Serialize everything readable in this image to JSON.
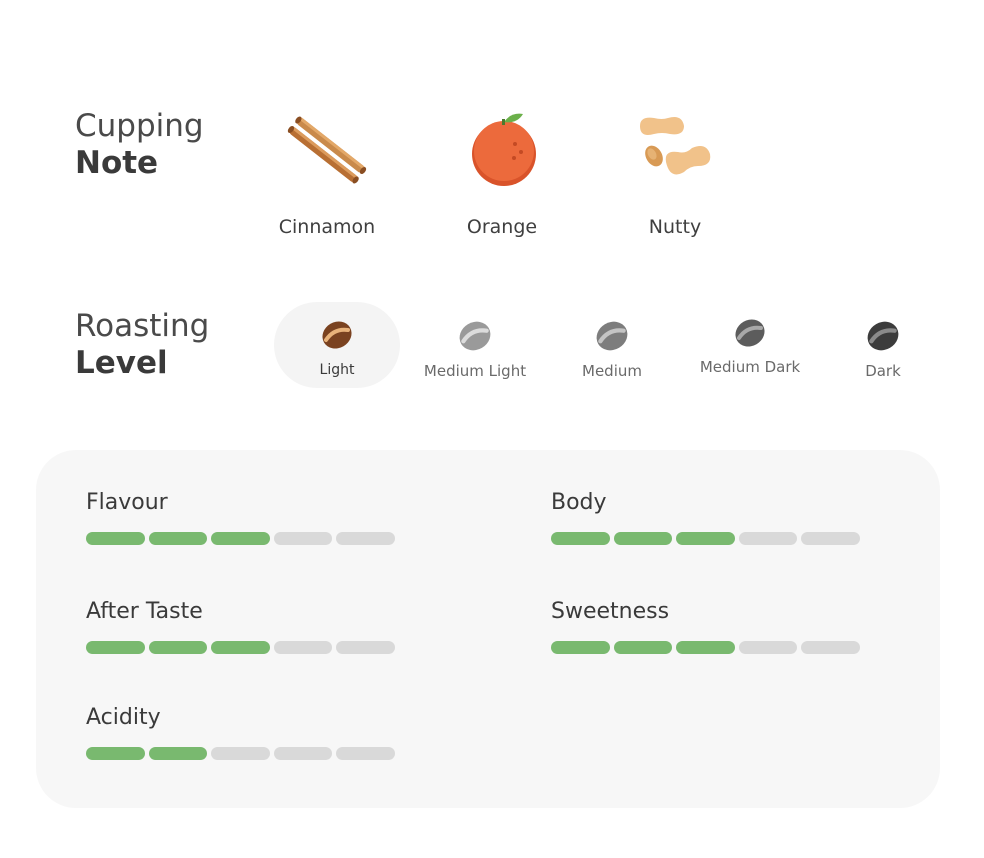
{
  "cupping": {
    "title_light": "Cupping",
    "title_bold": "Note",
    "notes": [
      {
        "label": "Cinnamon",
        "icon": "cinnamon-icon"
      },
      {
        "label": "Orange",
        "icon": "orange-icon"
      },
      {
        "label": "Nutty",
        "icon": "peanut-icon"
      }
    ]
  },
  "roasting": {
    "title_light": "Roasting",
    "title_bold": "Level",
    "selected": "Light",
    "levels": [
      {
        "label": "Light",
        "color": "#7a4220"
      },
      {
        "label": "Medium Light",
        "color": "#9a9a9a"
      },
      {
        "label": "Medium",
        "color": "#7d7d7d"
      },
      {
        "label": "Medium Dark",
        "color": "#5c5c5c"
      },
      {
        "label": "Dark",
        "color": "#3c3c3c"
      }
    ]
  },
  "attributes": [
    {
      "name": "Flavour",
      "score": 3,
      "max": 5
    },
    {
      "name": "Body",
      "score": 3,
      "max": 5
    },
    {
      "name": "After Taste",
      "score": 3,
      "max": 5
    },
    {
      "name": "Sweetness",
      "score": 3,
      "max": 5
    },
    {
      "name": "Acidity",
      "score": 2,
      "max": 5
    }
  ],
  "colors": {
    "active_segment": "#79b96f",
    "inactive_segment": "#d9d9d9",
    "panel_bg": "#f7f7f7"
  }
}
